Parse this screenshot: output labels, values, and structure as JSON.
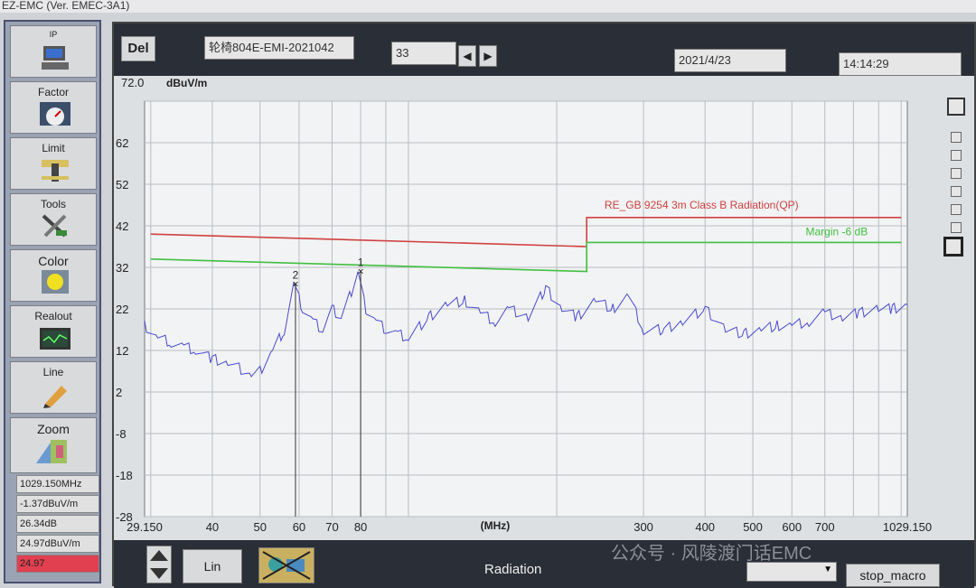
{
  "window": {
    "title": "EZ-EMC  (Ver. EMEC-3A1)"
  },
  "sidebar": {
    "buttons": [
      {
        "label": "IP",
        "icon": "computer-icon"
      },
      {
        "label": "Factor",
        "icon": "gauge-icon"
      },
      {
        "label": "Limit",
        "icon": "limit-icon"
      },
      {
        "label": "Tools",
        "icon": "tools-icon"
      },
      {
        "label": "Color",
        "icon": "color-icon"
      },
      {
        "label": "Realout",
        "icon": "monitor-icon"
      },
      {
        "label": "Line",
        "icon": "pen-icon"
      },
      {
        "label": "Zoom",
        "icon": "zoom-icon"
      }
    ],
    "readouts": [
      "1029.150MHz",
      "-1.37dBuV/m",
      "26.34dB",
      "24.97dBuV/m",
      "24.97"
    ]
  },
  "topbar": {
    "del_label": "Del",
    "file_name": "轮椅804E-EMI-2021042",
    "number": "33",
    "date": "2021/4/23",
    "time": "14:14:29"
  },
  "bottombar": {
    "scale_label": "Lin",
    "mode_label": "Radiation",
    "stop_label": "stop_macro",
    "dropdown_value": ""
  },
  "watermark": "公众号 · 风陵渡门话EMC",
  "colors": {
    "trace": "#4a4ad0",
    "limit": "#d04040",
    "margin": "#40c040",
    "grid": "#b8bcc2"
  },
  "chart_data": {
    "type": "line",
    "title": "",
    "ylabel": "dBuV/m",
    "xlabel": "(MHz)",
    "x_scale": "log",
    "xlim": [
      29.15,
      1029.15
    ],
    "ylim": [
      -28,
      72
    ],
    "y_ticks": [
      "72.0",
      "62",
      "52",
      "42",
      "32",
      "22",
      "12",
      "2",
      "-8",
      "-18",
      "-28"
    ],
    "y_tick_values": [
      72,
      62,
      52,
      42,
      32,
      22,
      12,
      2,
      -8,
      -18,
      -28
    ],
    "x_ticks": [
      "29.150",
      "40",
      "50",
      "60",
      "70",
      "80",
      "300",
      "400",
      "500",
      "600",
      "700",
      "1029.150"
    ],
    "x_tick_values": [
      29.15,
      40,
      50,
      60,
      70,
      80,
      300,
      400,
      500,
      600,
      700,
      1029.15
    ],
    "series": [
      {
        "name": "RE_GB 9254 3m Class B Radiation(QP)",
        "x": [
          30,
          230,
          230,
          1000
        ],
        "y": [
          40,
          37,
          44,
          44
        ]
      },
      {
        "name": "Margin -6 dB",
        "x": [
          30,
          230,
          230,
          1000
        ],
        "y": [
          34,
          31,
          38,
          38
        ]
      },
      {
        "name": "",
        "x": [
          29.15,
          31,
          33,
          35,
          37,
          40,
          43,
          45,
          48,
          50,
          53,
          56,
          58.5,
          61,
          64,
          67,
          70,
          73,
          76,
          79,
          82,
          86,
          90,
          95,
          100,
          110,
          120,
          130,
          140,
          150,
          160,
          175,
          190,
          205,
          220,
          240,
          260,
          280,
          300,
          330,
          360,
          400,
          440,
          480,
          520,
          560,
          600,
          650,
          700,
          760,
          820,
          900,
          960,
          1029.15
        ],
        "y": [
          18,
          15,
          14,
          13,
          12,
          10,
          9,
          8,
          6,
          7,
          12,
          17,
          28,
          22,
          19,
          17,
          22,
          20,
          25,
          31,
          22,
          19,
          17,
          16,
          15,
          20,
          23,
          24,
          21,
          19,
          22,
          20,
          27,
          22,
          20,
          24,
          22,
          25,
          17,
          17,
          19,
          22,
          17,
          16,
          17,
          18,
          18,
          19,
          21,
          20,
          21,
          22,
          22,
          23
        ]
      }
    ],
    "markers": [
      {
        "label": "1",
        "x": 80,
        "y": 31
      },
      {
        "label": "2",
        "x": 59,
        "y": 28
      }
    ]
  }
}
